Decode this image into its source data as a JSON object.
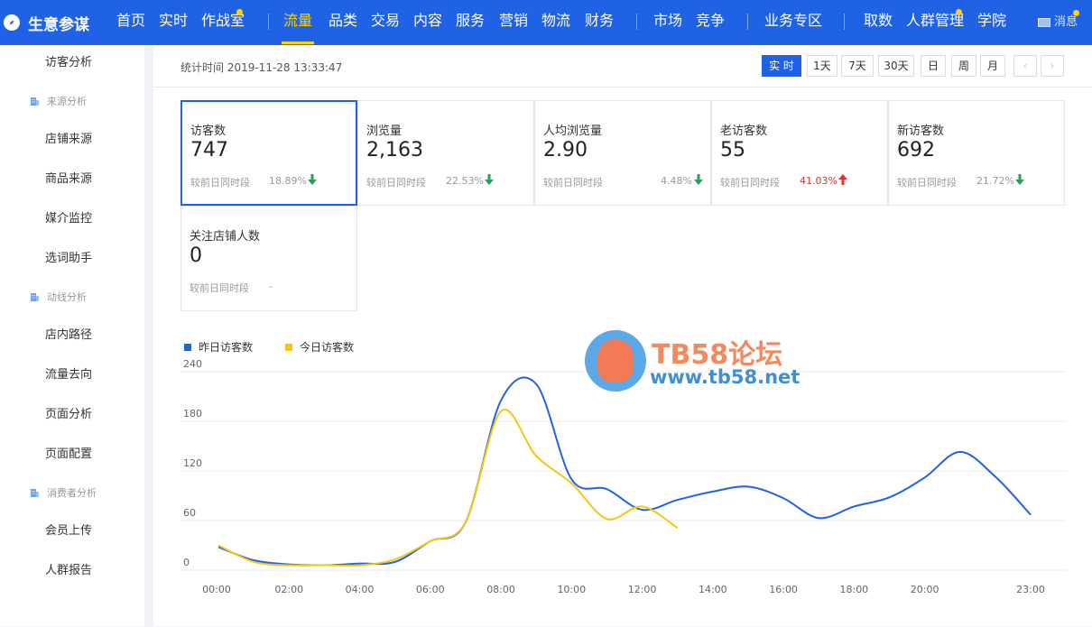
{
  "app": {
    "title": "生意参谋",
    "brand_color": "#2062e6",
    "highlight_color": "#ffd200"
  },
  "nav": {
    "items": [
      {
        "label": "首页"
      },
      {
        "label": "实时"
      },
      {
        "label": "作战室",
        "dot": true
      },
      {
        "label": "流量",
        "active": true
      },
      {
        "label": "品类"
      },
      {
        "label": "交易"
      },
      {
        "label": "内容"
      },
      {
        "label": "服务"
      },
      {
        "label": "营销"
      },
      {
        "label": "物流"
      },
      {
        "label": "财务"
      },
      {
        "label": "市场"
      },
      {
        "label": "竞争"
      },
      {
        "label": "业务专区"
      },
      {
        "label": "取数"
      },
      {
        "label": "人群管理",
        "dot": true
      },
      {
        "label": "学院"
      }
    ],
    "message_label": "消息"
  },
  "sidebar": {
    "items": [
      {
        "type": "item",
        "label": "访客分析"
      },
      {
        "type": "group",
        "label": "来源分析"
      },
      {
        "type": "item",
        "label": "店铺来源"
      },
      {
        "type": "item",
        "label": "商品来源"
      },
      {
        "type": "item",
        "label": "媒介监控"
      },
      {
        "type": "item",
        "label": "选词助手"
      },
      {
        "type": "group",
        "label": "动线分析"
      },
      {
        "type": "item",
        "label": "店内路径"
      },
      {
        "type": "item",
        "label": "流量去向"
      },
      {
        "type": "item",
        "label": "页面分析"
      },
      {
        "type": "item",
        "label": "页面配置"
      },
      {
        "type": "group",
        "label": "消费者分析"
      },
      {
        "type": "item",
        "label": "会员上传"
      },
      {
        "type": "item",
        "label": "人群报告"
      }
    ]
  },
  "toolbar": {
    "stat_time": "统计时间 2019-11-28 13:33:47",
    "ranges": [
      {
        "label": "实 时",
        "active": true
      },
      {
        "label": "1天"
      },
      {
        "label": "7天"
      },
      {
        "label": "30天"
      },
      {
        "label": "日"
      },
      {
        "label": "周"
      },
      {
        "label": "月"
      },
      {
        "label": "‹",
        "disabled": true
      },
      {
        "label": "›",
        "disabled": true
      }
    ]
  },
  "metrics": [
    {
      "label": "访客数",
      "value": "747",
      "compare_label": "较前日同时段",
      "pct": "18.89%",
      "direction": "down",
      "selected": true
    },
    {
      "label": "浏览量",
      "value": "2,163",
      "compare_label": "较前日同时段",
      "pct": "22.53%",
      "direction": "down"
    },
    {
      "label": "人均浏览量",
      "value": "2.90",
      "compare_label": "较前日同时段",
      "pct": "4.48%",
      "direction": "down"
    },
    {
      "label": "老访客数",
      "value": "55",
      "compare_label": "较前日同时段",
      "pct": "41.03%",
      "direction": "up"
    },
    {
      "label": "新访客数",
      "value": "692",
      "compare_label": "较前日同时段",
      "pct": "21.72%",
      "direction": "down"
    },
    {
      "label": "关注店铺人数",
      "value": "0",
      "compare_label": "较前日同时段",
      "pct": "-",
      "direction": "none"
    }
  ],
  "colors": {
    "down_arrow": "#1aa55a",
    "up_arrow": "#e0342b",
    "yesterday_series": "#2062e6",
    "today_series": "#f2c811"
  },
  "watermark": {
    "title": "TB58论坛",
    "url": "www.tb58.net"
  },
  "chart_data": {
    "type": "line",
    "title": "",
    "xlabel": "",
    "ylabel": "",
    "ylim": [
      0,
      240
    ],
    "yticks": [
      0,
      60,
      120,
      180,
      240
    ],
    "xticks": [
      "00:00",
      "02:00",
      "04:00",
      "06:00",
      "08:00",
      "10:00",
      "12:00",
      "14:00",
      "16:00",
      "18:00",
      "20:00",
      "23:00"
    ],
    "grid": true,
    "legend_position": "top-left",
    "x": [
      0,
      1,
      2,
      3,
      4,
      5,
      6,
      7,
      8,
      9,
      10,
      11,
      12,
      13,
      14,
      15,
      16,
      17,
      18,
      19,
      20,
      21,
      22,
      23
    ],
    "series": [
      {
        "name": "昨日访客数",
        "color": "#2062e6",
        "values": [
          28,
          12,
          7,
          6,
          8,
          10,
          35,
          58,
          205,
          225,
          110,
          98,
          73,
          85,
          95,
          101,
          87,
          63,
          77,
          88,
          112,
          143,
          113,
          67
        ]
      },
      {
        "name": "今日访客数",
        "color": "#f2c811",
        "values": [
          30,
          10,
          6,
          6,
          6,
          13,
          35,
          58,
          192,
          138,
          105,
          62,
          77,
          51
        ]
      }
    ]
  }
}
